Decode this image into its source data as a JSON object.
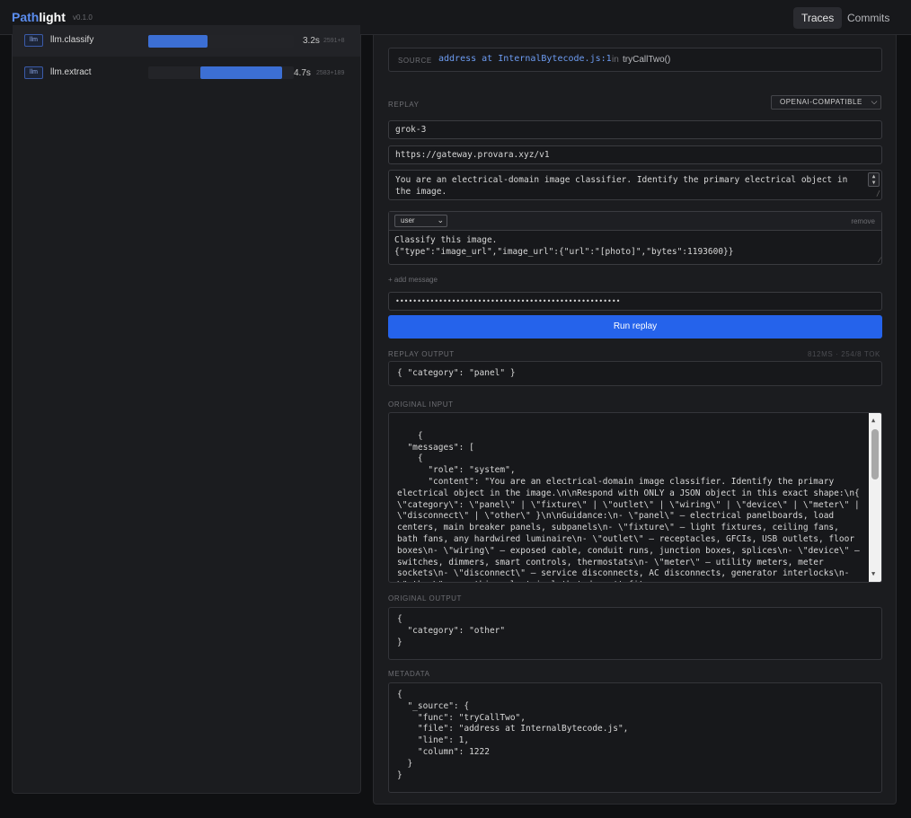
{
  "app": {
    "name_part1": "Path",
    "name_part2": "light",
    "version": "v0.1.0"
  },
  "nav": {
    "traces": "Traces",
    "commits": "Commits"
  },
  "spans": [
    {
      "tag": "llm",
      "name": "llm.classify",
      "duration": "3.2s",
      "tokens": "2591+8",
      "progress": 0.41
    },
    {
      "tag": "llm",
      "name": "llm.extract",
      "duration": "4.7s",
      "tokens": "2583+189",
      "progress": 0.56
    }
  ],
  "source": {
    "label": "SOURCE",
    "value": "address at InternalBytecode.js:1",
    "in": "in",
    "func": "tryCallTwo()"
  },
  "replay": {
    "label": "REPLAY",
    "provider": "OPENAI-COMPATIBLE",
    "model": "grok-3",
    "base_url": "https://gateway.provara.xyz/v1",
    "system_prompt": "You are an electrical-domain image classifier. Identify the primary electrical object in the image.",
    "message_role": "user",
    "remove_label": "remove",
    "message_text": "Classify this image.\n{\"type\":\"image_url\",\"image_url\":{\"url\":\"[photo]\",\"bytes\":1193600}}",
    "add_message": "+ add message",
    "api_key_mask": "••••••••••••••••••••••••••••••••••••••••••••••••••••",
    "run_label": "Run replay"
  },
  "replay_output": {
    "label": "REPLAY OUTPUT",
    "meta": "812MS · 254/8 TOK",
    "value": "{ \"category\": \"panel\" }"
  },
  "original_input": {
    "label": "ORIGINAL INPUT",
    "value": "{\n  \"messages\": [\n    {\n      \"role\": \"system\",\n      \"content\": \"You are an electrical-domain image classifier. Identify the primary electrical object in the image.\\n\\nRespond with ONLY a JSON object in this exact shape:\\n{ \\\"category\\\": \\\"panel\\\" | \\\"fixture\\\" | \\\"outlet\\\" | \\\"wiring\\\" | \\\"device\\\" | \\\"meter\\\" | \\\"disconnect\\\" | \\\"other\\\" }\\n\\nGuidance:\\n- \\\"panel\\\" — electrical panelboards, load centers, main breaker panels, subpanels\\n- \\\"fixture\\\" — light fixtures, ceiling fans, bath fans, any hardwired luminaire\\n- \\\"outlet\\\" — receptacles, GFCIs, USB outlets, floor boxes\\n- \\\"wiring\\\" — exposed cable, conduit runs, junction boxes, splices\\n- \\\"device\\\" — switches, dimmers, smart controls, thermostats\\n- \\\"meter\\\" — utility meters, meter sockets\\n- \\\"disconnect\\\" — service disconnects, AC disconnects, generator interlocks\\n- \\\"other\\\" — anything electrical that doesn't fit"
  },
  "original_output": {
    "label": "ORIGINAL OUTPUT",
    "value": "{\n  \"category\": \"other\"\n}"
  },
  "metadata": {
    "label": "METADATA",
    "value": "{\n  \"_source\": {\n    \"func\": \"tryCallTwo\",\n    \"file\": \"address at InternalBytecode.js\",\n    \"line\": 1,\n    \"column\": 1222\n  }\n}"
  }
}
